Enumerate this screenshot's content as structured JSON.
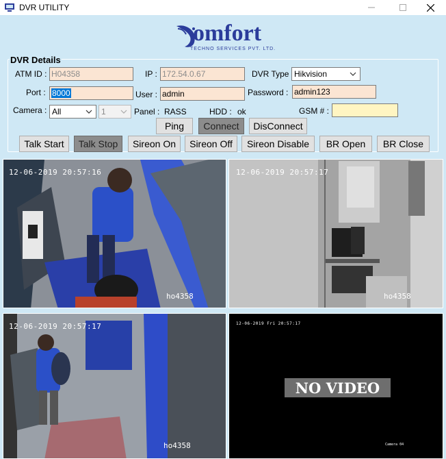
{
  "window": {
    "title": "DVR UTILITY",
    "min_icon": "minimize-icon",
    "max_icon": "maximize-icon",
    "close_icon": "close-icon"
  },
  "logo": {
    "main": "omfort",
    "sub": "TECHNO SERVICES PVT. LTD."
  },
  "details": {
    "legend": "DVR Details",
    "atm_id_label": "ATM ID :",
    "atm_id_value": "H04358",
    "ip_label": "IP :",
    "ip_value": "172.54.0.67",
    "dvr_type_label": "DVR Type :",
    "dvr_type_value": "Hikvision",
    "port_label": "Port :",
    "port_value": "8000",
    "user_label": "User :",
    "user_value": "admin",
    "password_label": "Password :",
    "password_value": "admin123",
    "camera_label": "Camera :",
    "camera_value": "All",
    "camera_number": "1",
    "panel_label": "Panel :",
    "panel_value": "RASS",
    "hdd_label": "HDD :",
    "hdd_value": "ok",
    "gsm_label": "GSM # :",
    "gsm_value": ""
  },
  "buttons": {
    "ping": "Ping",
    "connect": "Connect",
    "disconnect": "DisConnect",
    "talk_start": "Talk Start",
    "talk_stop": "Talk Stop",
    "sireon_on": "Sireon On",
    "sireon_off": "Sireon Off",
    "sireon_disable": "Sireon Disable",
    "br_open": "BR Open",
    "br_close": "BR Close"
  },
  "cameras": [
    {
      "timestamp": "12-06-2019 20:57:16",
      "tag": "ho4358"
    },
    {
      "timestamp": "12-06-2019 20:57:17",
      "tag": "ho4358"
    },
    {
      "timestamp": "12-06-2019 20:57:17",
      "tag": "ho4358"
    },
    {
      "timestamp": "12-06-2019 Fri 20:57:17",
      "tag": "Camera 04",
      "status": "NO VIDEO"
    }
  ]
}
